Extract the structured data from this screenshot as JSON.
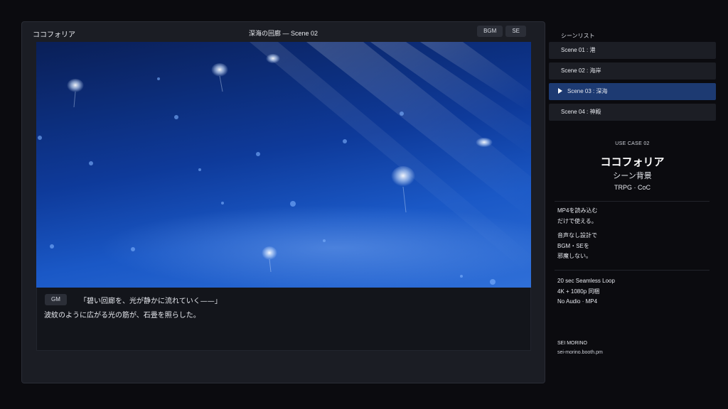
{
  "window": {
    "app_title": "ココフォリア",
    "scene_title": "深海の回廊 — Scene 02",
    "buttons": {
      "bgm": "BGM",
      "se": "SE"
    }
  },
  "dialogue": {
    "speaker": "GM",
    "line1": "「碧い回廊を、光が静かに流れていく——」",
    "line2": "波紋のように広がる光の筋が、石畳を照らした。"
  },
  "sidebar": {
    "label": "シーンリスト",
    "scenes": [
      {
        "label": "Scene 01 : 港"
      },
      {
        "label": "Scene 02 : 海岸"
      },
      {
        "label": "Scene 03 : 深海"
      },
      {
        "label": "Scene 04 : 神殿"
      }
    ],
    "active_index": 2
  },
  "info": {
    "usecase": "USE CASE 02",
    "title": "ココフォリア",
    "subtitle": "シーン背景",
    "tagline": "TRPG · CoC",
    "note1": [
      "MP4を読み込む",
      "だけで使える。"
    ],
    "note2": [
      "音声なし設計で",
      "BGM・SEを",
      "邪魔しない。"
    ],
    "specs": [
      "20 sec Seamless Loop",
      "4K + 1080p 同梱",
      "No Audio · MP4"
    ],
    "author": "SEI MORINO",
    "url": "sei-morino.booth.pm"
  },
  "colors": {
    "background": "#0b0b0f",
    "panel": "#1b1d24",
    "active_scene": "#1d3a72",
    "ocean_deep": "#0a1f57",
    "ocean_light": "#2f6fd8"
  }
}
